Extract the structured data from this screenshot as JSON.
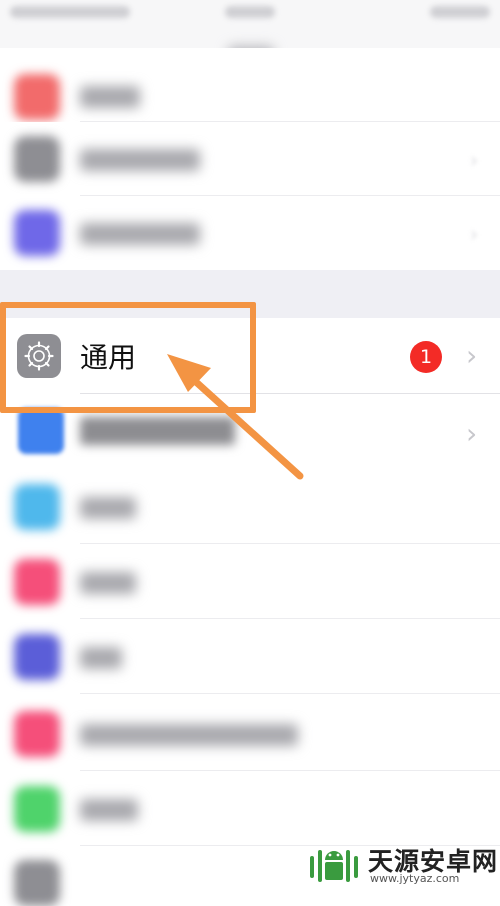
{
  "settings": {
    "general_label": "通用",
    "general_badge": "1",
    "chevron": "›",
    "rows_above": [
      {
        "icon_color": "#f26b6b",
        "blurred": true
      },
      {
        "icon_color": "#8e8e93",
        "blurred": true
      },
      {
        "icon_color": "#6f68e8",
        "blurred": true
      }
    ],
    "rows_below": [
      {
        "icon_color": "#3f81ee",
        "blurred": true
      },
      {
        "icon_color": "#4fb8ec",
        "blurred": true
      },
      {
        "icon_color": "#f54f7a",
        "blurred": true
      },
      {
        "icon_color": "#5b5ed8",
        "blurred": true
      },
      {
        "icon_color": "#f54f7a",
        "blurred": true
      },
      {
        "icon_color": "#4fd36b",
        "blurred": true
      },
      {
        "icon_color": "#8e8e93",
        "blurred": true
      }
    ]
  },
  "annotation": {
    "highlight_color": "#f39443",
    "arrow_color": "#f39443"
  },
  "watermark": {
    "title": "天源安卓网",
    "url": "www.jytyaz.com"
  }
}
